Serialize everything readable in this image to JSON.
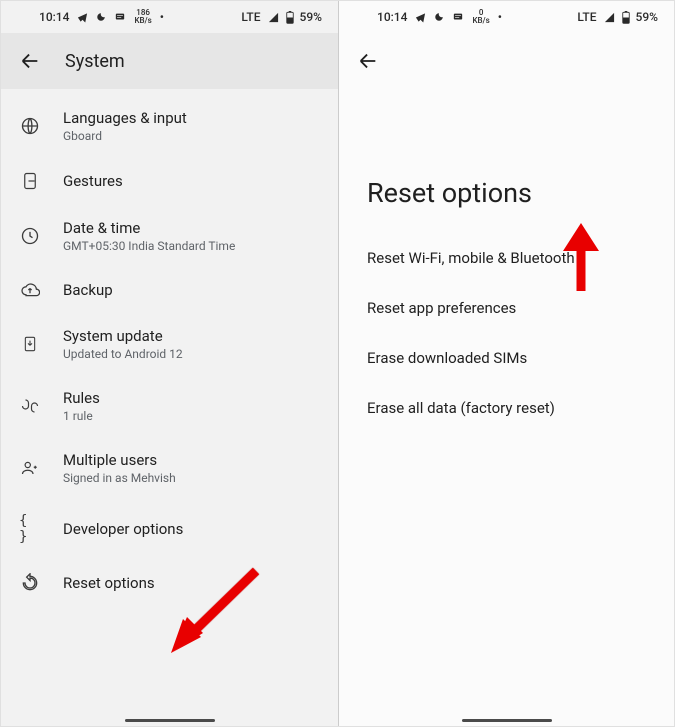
{
  "status": {
    "time": "10:14",
    "kbs_left": "186",
    "kbs_right": "0",
    "kbs_unit": "KB/s",
    "network": "LTE",
    "battery": "59%"
  },
  "left": {
    "title": "System",
    "items": [
      {
        "icon": "globe",
        "title": "Languages & input",
        "sub": "Gboard"
      },
      {
        "icon": "gesture",
        "title": "Gestures"
      },
      {
        "icon": "clock",
        "title": "Date & time",
        "sub": "GMT+05:30 India Standard Time"
      },
      {
        "icon": "backup",
        "title": "Backup"
      },
      {
        "icon": "update",
        "title": "System update",
        "sub": "Updated to Android 12"
      },
      {
        "icon": "rules",
        "title": "Rules",
        "sub": "1 rule"
      },
      {
        "icon": "users",
        "title": "Multiple users",
        "sub": "Signed in as Mehvish"
      },
      {
        "icon": "dev",
        "title": "Developer options"
      },
      {
        "icon": "reset",
        "title": "Reset options"
      }
    ]
  },
  "right": {
    "title": "Reset options",
    "options": [
      "Reset Wi-Fi, mobile & Bluetooth",
      "Reset app preferences",
      "Erase downloaded SIMs",
      "Erase all data (factory reset)"
    ]
  }
}
